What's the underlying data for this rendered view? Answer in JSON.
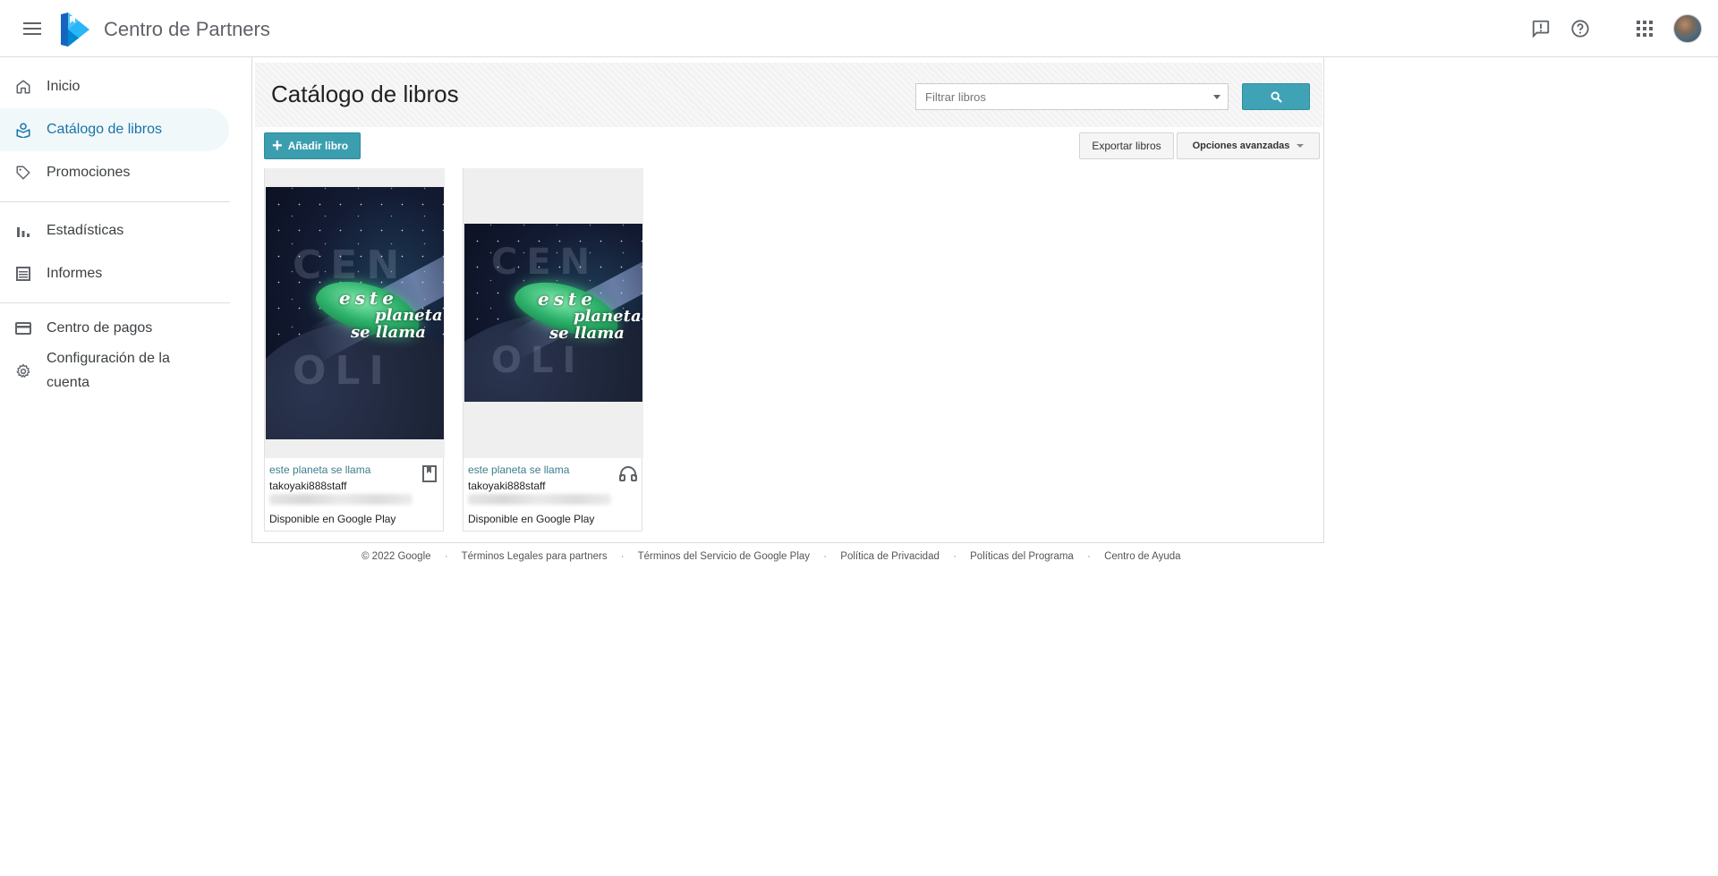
{
  "header": {
    "title": "Centro de Partners",
    "icons": {
      "menu": "menu-icon",
      "feedback": "feedback-icon",
      "help": "help-icon",
      "apps": "apps-grid-icon",
      "avatar": "account-avatar"
    }
  },
  "sidebar": {
    "items": [
      {
        "label": "Inicio",
        "icon": "home-icon",
        "active": false
      },
      {
        "label": "Catálogo de libros",
        "icon": "book-catalog-icon",
        "active": true
      },
      {
        "label": "Promociones",
        "icon": "tag-icon",
        "active": false
      },
      {
        "label": "Estadísticas",
        "icon": "bar-chart-icon",
        "active": false
      },
      {
        "label": "Informes",
        "icon": "list-report-icon",
        "active": false
      },
      {
        "label": "Centro de pagos",
        "icon": "credit-card-icon",
        "active": false
      },
      {
        "label": "Configuración de la cuenta",
        "icon": "gear-icon",
        "active": false
      }
    ]
  },
  "main": {
    "title": "Catálogo de libros",
    "filter_placeholder": "Filtrar libros",
    "add_book_label": "Añadir libro",
    "export_label": "Exportar libros",
    "advanced_label": "Opciones avanzadas",
    "books": [
      {
        "title": "este planeta se llama",
        "author": "takoyaki888staff",
        "status": "Disponible en Google Play",
        "format_icon": "ebook-bookmark-icon",
        "cover_text": [
          "este",
          "planeta",
          "se llama"
        ],
        "cover_ghost_text": [
          "CEN",
          "OLI"
        ]
      },
      {
        "title": "este planeta se llama",
        "author": "takoyaki888staff",
        "status": "Disponible en Google Play",
        "format_icon": "audiobook-headphones-icon",
        "cover_text": [
          "este",
          "planeta",
          "se llama"
        ],
        "cover_ghost_text": [
          "CEN",
          "OLI"
        ]
      }
    ]
  },
  "footer": {
    "copyright": "© 2022 Google",
    "links": [
      "Términos Legales para partners",
      "Términos del Servicio de Google Play",
      "Política de Privacidad",
      "Políticas del Programa",
      "Centro de Ayuda"
    ]
  },
  "colors": {
    "accent": "#3b9eaf",
    "active_nav_text": "#1a73a8",
    "link_title": "#3d7e8c"
  }
}
